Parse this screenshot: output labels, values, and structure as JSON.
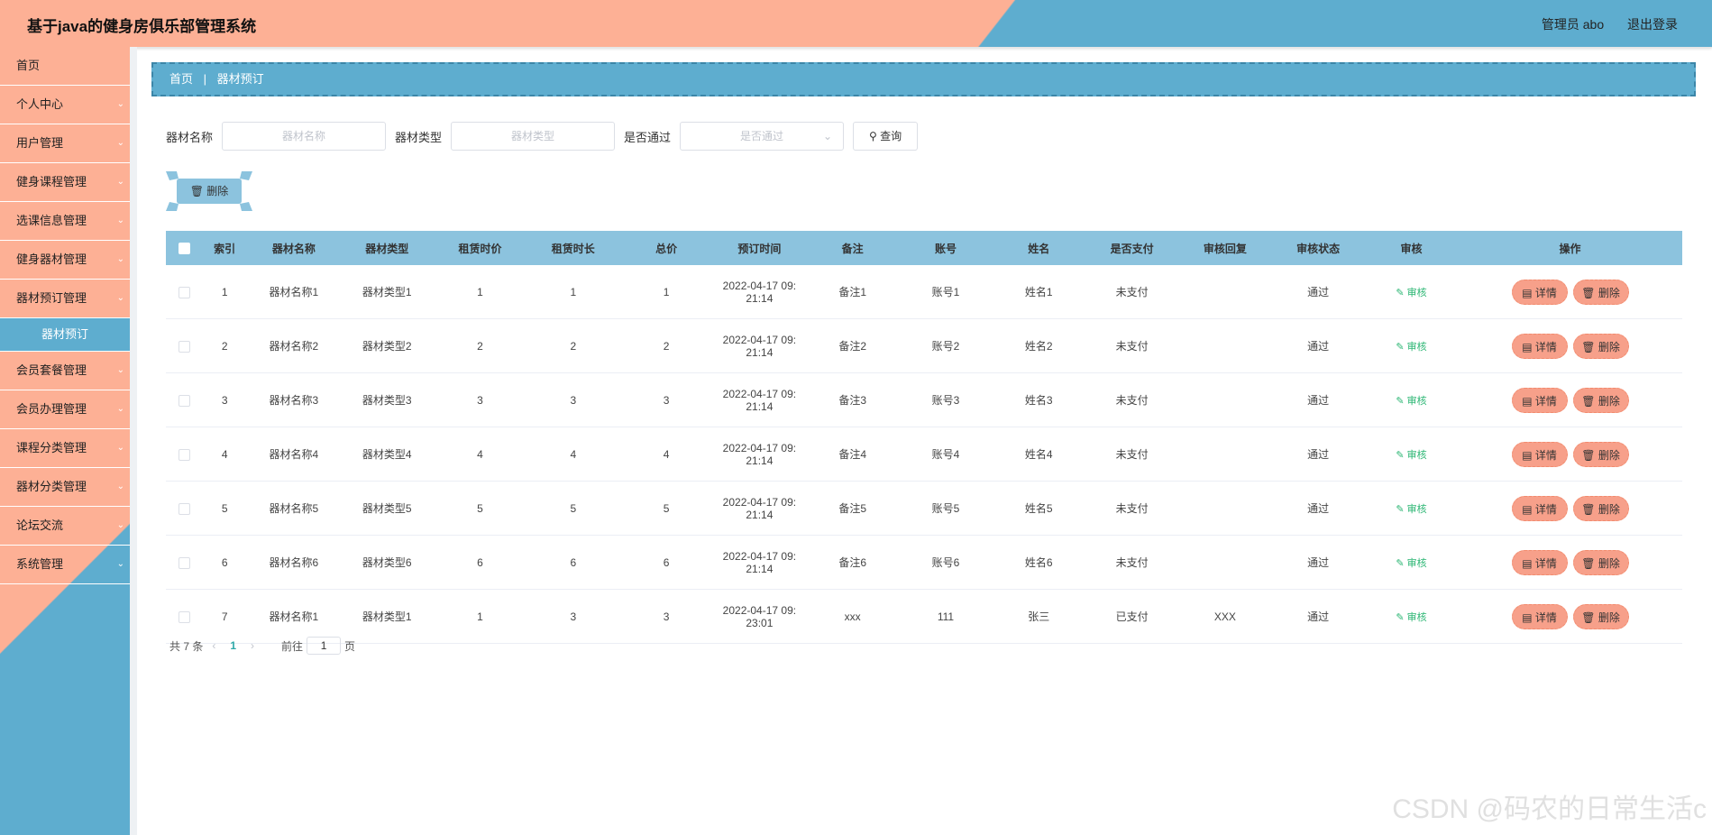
{
  "header": {
    "title": "基于java的健身房俱乐部管理系统",
    "user_label": "管理员 abo",
    "logout_label": "退出登录"
  },
  "sidebar": {
    "items": [
      {
        "label": "首页",
        "arrow": false
      },
      {
        "label": "个人中心",
        "arrow": true
      },
      {
        "label": "用户管理",
        "arrow": true
      },
      {
        "label": "健身课程管理",
        "arrow": true
      },
      {
        "label": "选课信息管理",
        "arrow": true
      },
      {
        "label": "健身器材管理",
        "arrow": true
      },
      {
        "label": "器材预订管理",
        "arrow": true
      },
      {
        "label": "会员套餐管理",
        "arrow": true
      },
      {
        "label": "会员办理管理",
        "arrow": true
      },
      {
        "label": "课程分类管理",
        "arrow": true
      },
      {
        "label": "器材分类管理",
        "arrow": true
      },
      {
        "label": "论坛交流",
        "arrow": true
      },
      {
        "label": "系统管理",
        "arrow": true
      }
    ],
    "active_sub": "器材预订"
  },
  "breadcrumb": {
    "home": "首页",
    "current": "器材预订"
  },
  "filters": {
    "name_label": "器材名称",
    "name_placeholder": "器材名称",
    "type_label": "器材类型",
    "type_placeholder": "器材类型",
    "pass_label": "是否通过",
    "pass_placeholder": "是否通过",
    "query_label": "查询"
  },
  "delete_label": "删除",
  "table": {
    "columns": [
      "索引",
      "器材名称",
      "器材类型",
      "租赁时价",
      "租赁时长",
      "总价",
      "预订时间",
      "备注",
      "账号",
      "姓名",
      "是否支付",
      "审核回复",
      "审核状态",
      "审核",
      "操作"
    ],
    "rows": [
      {
        "idx": "1",
        "name": "器材名称1",
        "type": "器材类型1",
        "price": "1",
        "hours": "1",
        "total": "1",
        "time1": "2022-04-17 09:",
        "time2": "21:14",
        "note": "备注1",
        "acct": "账号1",
        "person": "姓名1",
        "paid": "未支付",
        "reply": "",
        "status": "通过"
      },
      {
        "idx": "2",
        "name": "器材名称2",
        "type": "器材类型2",
        "price": "2",
        "hours": "2",
        "total": "2",
        "time1": "2022-04-17 09:",
        "time2": "21:14",
        "note": "备注2",
        "acct": "账号2",
        "person": "姓名2",
        "paid": "未支付",
        "reply": "",
        "status": "通过"
      },
      {
        "idx": "3",
        "name": "器材名称3",
        "type": "器材类型3",
        "price": "3",
        "hours": "3",
        "total": "3",
        "time1": "2022-04-17 09:",
        "time2": "21:14",
        "note": "备注3",
        "acct": "账号3",
        "person": "姓名3",
        "paid": "未支付",
        "reply": "",
        "status": "通过"
      },
      {
        "idx": "4",
        "name": "器材名称4",
        "type": "器材类型4",
        "price": "4",
        "hours": "4",
        "total": "4",
        "time1": "2022-04-17 09:",
        "time2": "21:14",
        "note": "备注4",
        "acct": "账号4",
        "person": "姓名4",
        "paid": "未支付",
        "reply": "",
        "status": "通过"
      },
      {
        "idx": "5",
        "name": "器材名称5",
        "type": "器材类型5",
        "price": "5",
        "hours": "5",
        "total": "5",
        "time1": "2022-04-17 09:",
        "time2": "21:14",
        "note": "备注5",
        "acct": "账号5",
        "person": "姓名5",
        "paid": "未支付",
        "reply": "",
        "status": "通过"
      },
      {
        "idx": "6",
        "name": "器材名称6",
        "type": "器材类型6",
        "price": "6",
        "hours": "6",
        "total": "6",
        "time1": "2022-04-17 09:",
        "time2": "21:14",
        "note": "备注6",
        "acct": "账号6",
        "person": "姓名6",
        "paid": "未支付",
        "reply": "",
        "status": "通过"
      },
      {
        "idx": "7",
        "name": "器材名称1",
        "type": "器材类型1",
        "price": "1",
        "hours": "3",
        "total": "3",
        "time1": "2022-04-17 09:",
        "time2": "23:01",
        "note": "xxx",
        "acct": "111",
        "person": "张三",
        "paid": "已支付",
        "reply": "XXX",
        "status": "通过"
      }
    ],
    "audit_label": "审核",
    "detail_label": "详情",
    "delete_label": "删除"
  },
  "pager": {
    "total": "共 7 条",
    "current": "1",
    "goto_label": "前往",
    "page_value": "1",
    "page_unit": "页"
  },
  "watermark": "CSDN @码农的日常生活c",
  "colors": {
    "salmon": "#fdb095",
    "blue": "#5eadcf",
    "table_head": "#8cc3de",
    "op_button": "#f7a08a",
    "audit_green": "#2bb673"
  }
}
